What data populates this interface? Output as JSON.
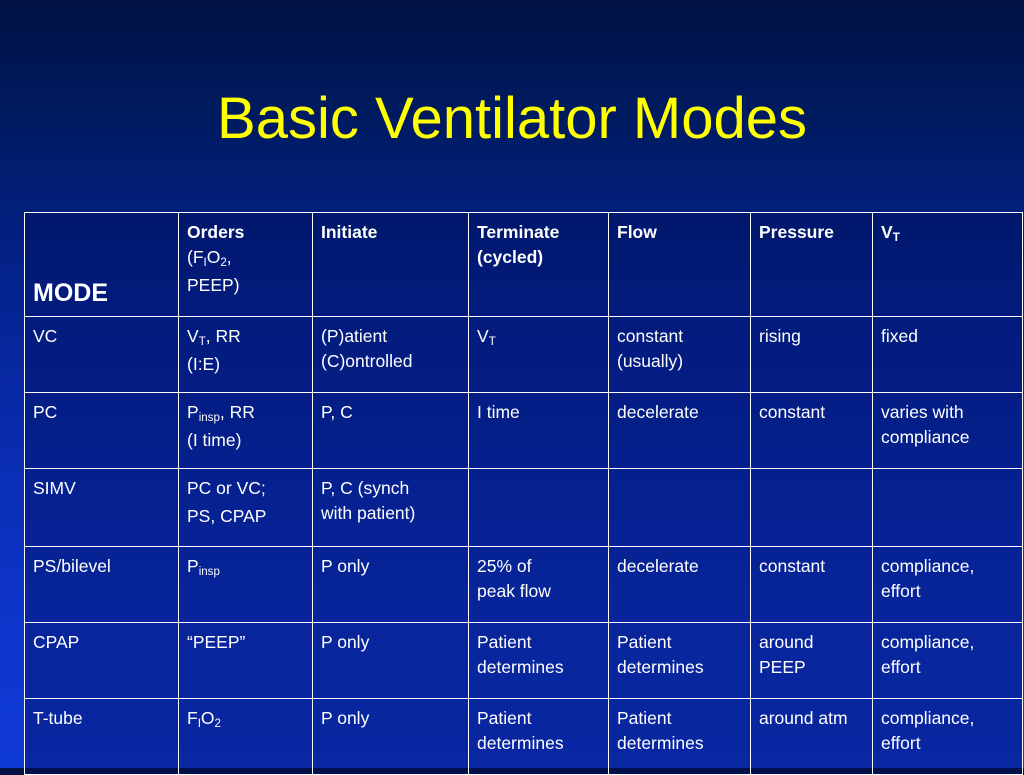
{
  "slide": {
    "title": "Basic Ventilator Modes",
    "title_color": "#ffff00",
    "background_top_color": "#001243",
    "background_bottom_color": "#0f39d6",
    "table_border_color": "#ffffff",
    "text_color": "#ffffff"
  },
  "table": {
    "columns": [
      "MODE",
      "Orders (FIO2, PEEP)",
      "Initiate",
      "Terminate (cycled)",
      "Flow",
      "Pressure",
      "VT"
    ],
    "header": {
      "mode": "MODE",
      "orders_main": "Orders",
      "orders_sub_line1": "(F",
      "orders_sub_i": "I",
      "orders_sub_line2": "O",
      "orders_sub_2": "2",
      "orders_sub_line3": ",",
      "orders_sub_line4": "PEEP)",
      "initiate": "Initiate",
      "terminate_line1": "Terminate",
      "terminate_line2": "(cycled)",
      "flow": "Flow",
      "pressure": "Pressure",
      "vt_v": "V",
      "vt_t": "T"
    },
    "rows": [
      {
        "mode": "VC",
        "orders_line1_a": "V",
        "orders_line1_sub": "T",
        "orders_line1_b": ", RR",
        "orders_line2": "(I:E)",
        "initiate_line1": "(P)atient",
        "initiate_line2": "(C)ontrolled",
        "terminate_a": "V",
        "terminate_sub": "T",
        "terminate_b": "",
        "flow_line1": "constant",
        "flow_line2": "(usually)",
        "pressure": "rising",
        "vt_line1": "fixed",
        "vt_line2": ""
      },
      {
        "mode": "PC",
        "orders_line1_a": "P",
        "orders_line1_sub": "insp",
        "orders_line1_b": ", RR",
        "orders_line2": "(I time)",
        "initiate_line1": "P, C",
        "initiate_line2": "",
        "terminate_a": "I time",
        "terminate_sub": "",
        "terminate_b": "",
        "flow_line1": "decelerate",
        "flow_line2": "",
        "pressure": "constant",
        "vt_line1": "varies with",
        "vt_line2": "compliance"
      },
      {
        "mode": "SIMV",
        "orders_line1_a": "PC or VC;",
        "orders_line1_sub": "",
        "orders_line1_b": "",
        "orders_line2": "PS, CPAP",
        "initiate_line1": "P, C (synch",
        "initiate_line2": "with patient)",
        "terminate_a": "",
        "terminate_sub": "",
        "terminate_b": "",
        "flow_line1": "",
        "flow_line2": "",
        "pressure": "",
        "vt_line1": "",
        "vt_line2": ""
      },
      {
        "mode": "PS/bilevel",
        "orders_line1_a": "P",
        "orders_line1_sub": "insp",
        "orders_line1_b": "",
        "orders_line2": "",
        "initiate_line1": "P only",
        "initiate_line2": "",
        "terminate_a": "25% of",
        "terminate_sub": "",
        "terminate_b": "peak flow",
        "flow_line1": "decelerate",
        "flow_line2": "",
        "pressure": "constant",
        "vt_line1": "compliance,",
        "vt_line2": "effort"
      },
      {
        "mode": "CPAP",
        "orders_line1_a": "“PEEP”",
        "orders_line1_sub": "",
        "orders_line1_b": "",
        "orders_line2": "",
        "initiate_line1": "P only",
        "initiate_line2": "",
        "terminate_a": "Patient",
        "terminate_sub": "",
        "terminate_b": "determines",
        "flow_line1": "Patient",
        "flow_line2": "determines",
        "pressure": "around PEEP",
        "vt_line1": "compliance,",
        "vt_line2": "effort"
      },
      {
        "mode": "T-tube",
        "orders_line1_a": "F",
        "orders_line1_sub": "I",
        "orders_line1_b": "O",
        "orders_line1_sub2": "2",
        "orders_line2": "",
        "initiate_line1": "P only",
        "initiate_line2": "",
        "terminate_a": "Patient",
        "terminate_sub": "",
        "terminate_b": "determines",
        "flow_line1": "Patient",
        "flow_line2": "determines",
        "pressure": "around atm",
        "vt_line1": "compliance,",
        "vt_line2": "effort"
      }
    ]
  }
}
